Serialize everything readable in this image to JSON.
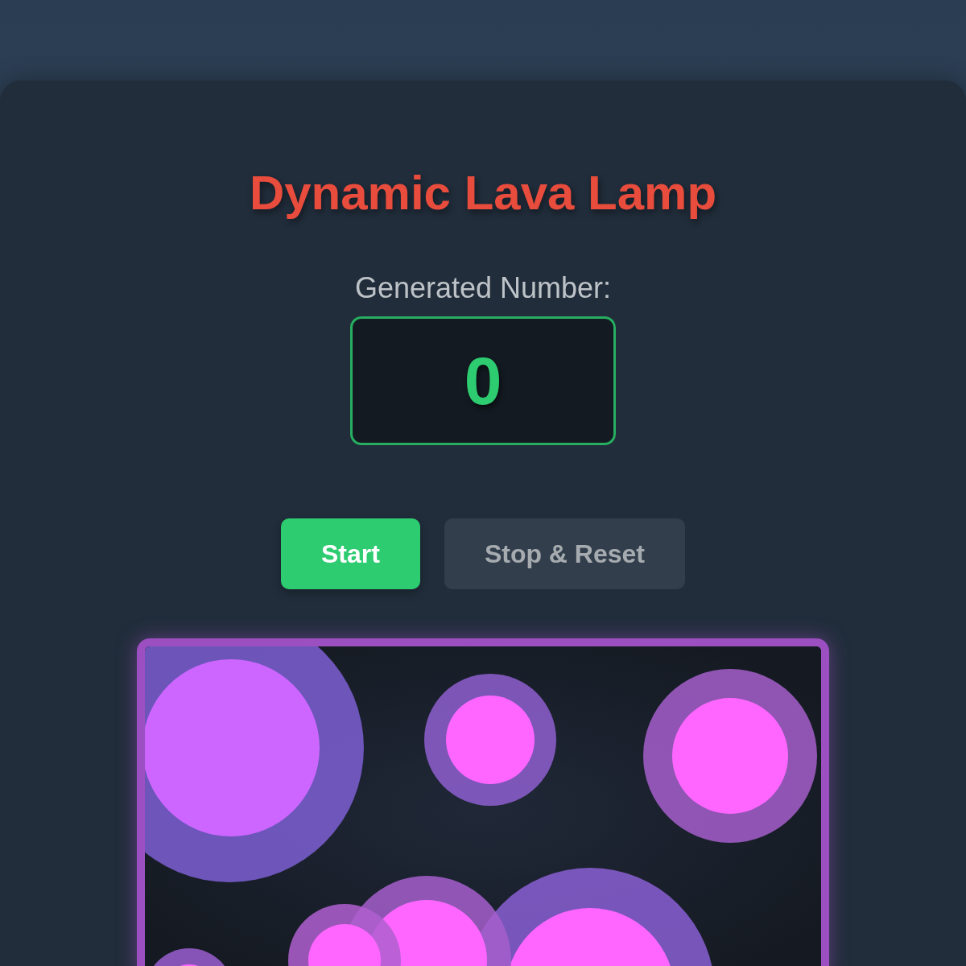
{
  "title": "Dynamic Lava Lamp",
  "number_label": "Generated Number:",
  "number_value": "0",
  "buttons": [
    {
      "label": "Start",
      "kind": "primary",
      "disabled": false
    },
    {
      "label": "Stop & Reset",
      "kind": "secondary",
      "disabled": true
    }
  ],
  "lava_lamp": {
    "kind": "drawing"
  }
}
